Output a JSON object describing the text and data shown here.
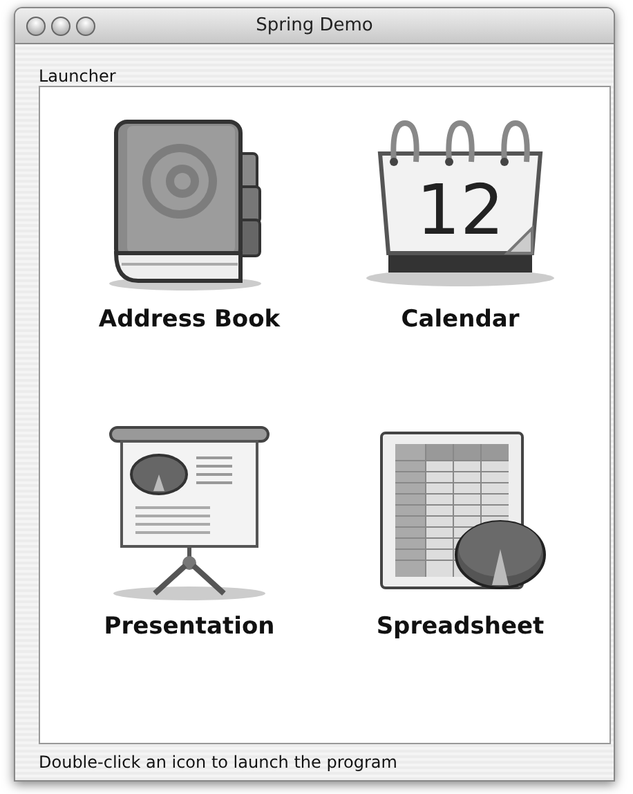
{
  "window": {
    "title": "Spring Demo"
  },
  "panel": {
    "title": "Launcher"
  },
  "launchers": [
    {
      "kind": "address-book",
      "label": "Address Book"
    },
    {
      "kind": "calendar",
      "label": "Calendar"
    },
    {
      "kind": "presentation",
      "label": "Presentation"
    },
    {
      "kind": "spreadsheet",
      "label": "Spreadsheet"
    }
  ],
  "calendar_icon": {
    "date": "12"
  },
  "status_bar": "Double-click an icon to launch the program"
}
